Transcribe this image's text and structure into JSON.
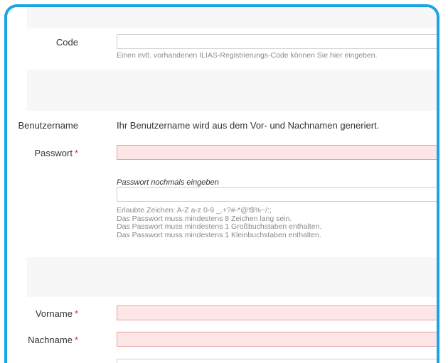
{
  "colors": {
    "frame_border": "#1aa3e8",
    "required_star": "#c0392b",
    "error_field": "#ffe6e6"
  },
  "code": {
    "label": "Code",
    "help": "Einen evtl. vorhandenen ILIAS-Registrierungs-Code können Sie hier eingeben."
  },
  "username": {
    "label": "Benutzername",
    "text": "Ihr Benutzername wird aus dem Vor- und Nachnamen generiert."
  },
  "password": {
    "label": "Passwort",
    "required": "*",
    "repeat_label": "Passwort nochmals eingeben",
    "rules": [
      "Erlaubte Zeichen: A-Z a-z 0-9 _.+?#-*@!$%~/:;",
      "Das Passwort muss mindestens 8 Zeichen lang sein.",
      "Das Passwort muss mindestens 1 Großbuchstaben enthalten.",
      "Das Passwort muss mindestens 1 Kleinbuchstaben enthalten."
    ]
  },
  "firstname": {
    "label": "Vorname",
    "required": "*"
  },
  "lastname": {
    "label": "Nachname",
    "required": "*"
  }
}
